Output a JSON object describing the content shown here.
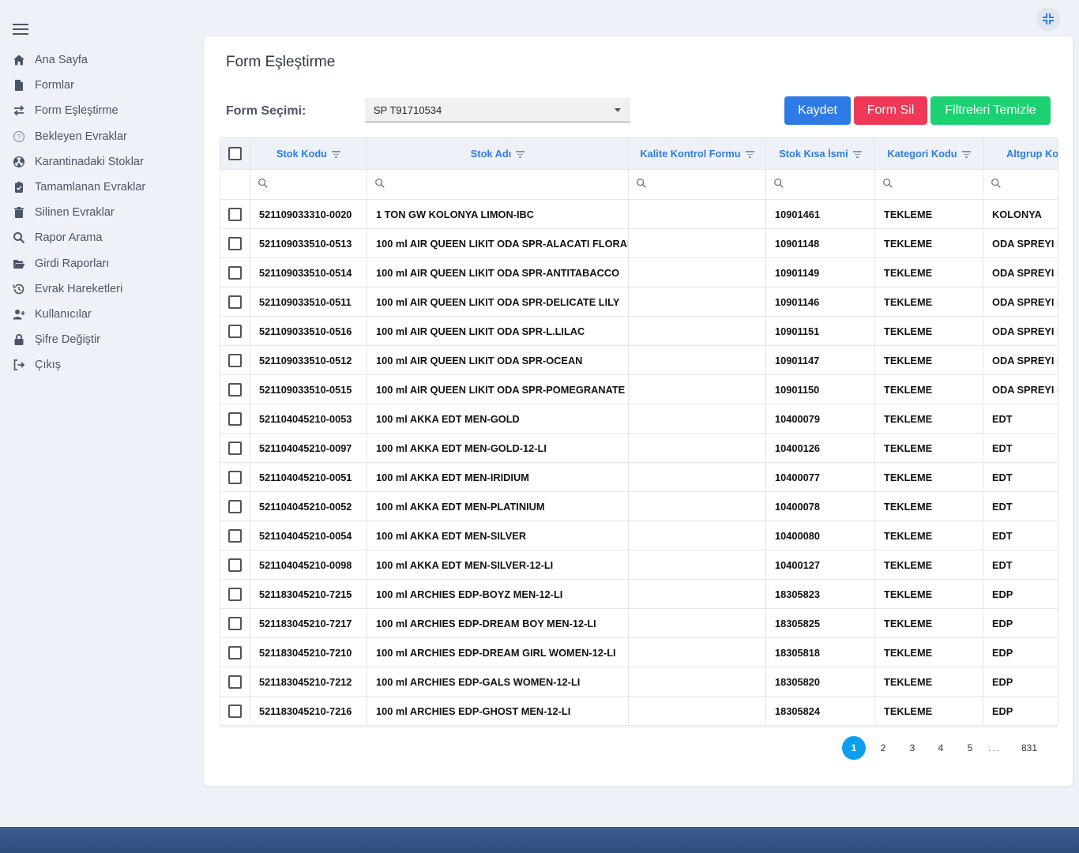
{
  "sidebar": {
    "items": [
      {
        "label": "Ana Sayfa",
        "icon": "home-icon"
      },
      {
        "label": "Formlar",
        "icon": "file-icon"
      },
      {
        "label": "Form Eşleştirme",
        "icon": "exchange-icon"
      },
      {
        "label": "Bekleyen Evraklar",
        "icon": "question-circle-icon"
      },
      {
        "label": "Karantinadaki Stoklar",
        "icon": "radiation-icon"
      },
      {
        "label": "Tamamlanan Evraklar",
        "icon": "clipboard-check-icon"
      },
      {
        "label": "Silinen Evraklar",
        "icon": "trash-icon"
      },
      {
        "label": "Rapor Arama",
        "icon": "search-icon"
      },
      {
        "label": "Girdi Raporları",
        "icon": "folder-open-icon"
      },
      {
        "label": "Evrak Hareketleri",
        "icon": "history-icon"
      },
      {
        "label": "Kullanıcılar",
        "icon": "user-plus-icon"
      },
      {
        "label": "Şifre Değiştir",
        "icon": "lock-icon"
      },
      {
        "label": "Çıkış",
        "icon": "sign-out-icon"
      }
    ]
  },
  "main": {
    "title": "Form Eşleştirme",
    "form_label": "Form Seçimi:",
    "form_select_value": "SP T91710534",
    "buttons": {
      "save": "Kaydet",
      "delete": "Form Sil",
      "clear": "Filtreleri Temizle"
    },
    "colors": {
      "save": "#2f7be6",
      "delete": "#ef3957",
      "clear": "#1bd171",
      "accent": "#2f7be6",
      "page_active": "#0aa0ee"
    }
  },
  "table": {
    "columns": [
      "Stok Kodu",
      "Stok Adı",
      "Kalite Kontrol Formu",
      "Stok Kısa İsmi",
      "Kategori Kodu",
      "Altgrup Ko"
    ],
    "rows": [
      [
        "521109033310-0020",
        "1 TON GW KOLONYA LIMON-IBC",
        "",
        "10901461",
        "TEKLEME",
        "KOLONYA"
      ],
      [
        "521109033510-0513",
        "100 ml AIR QUEEN LIKIT ODA SPR-ALACATI FLORAL",
        "",
        "10901148",
        "TEKLEME",
        "ODA SPREYI S"
      ],
      [
        "521109033510-0514",
        "100 ml AIR QUEEN LIKIT ODA SPR-ANTITABACCO",
        "",
        "10901149",
        "TEKLEME",
        "ODA SPREYI S"
      ],
      [
        "521109033510-0511",
        "100 ml AIR QUEEN LIKIT ODA SPR-DELICATE LILY",
        "",
        "10901146",
        "TEKLEME",
        "ODA SPREYI S"
      ],
      [
        "521109033510-0516",
        "100 ml AIR QUEEN LIKIT ODA SPR-L.LILAC",
        "",
        "10901151",
        "TEKLEME",
        "ODA SPREYI S"
      ],
      [
        "521109033510-0512",
        "100 ml AIR QUEEN LIKIT ODA SPR-OCEAN",
        "",
        "10901147",
        "TEKLEME",
        "ODA SPREYI S"
      ],
      [
        "521109033510-0515",
        "100 ml AIR QUEEN LIKIT ODA SPR-POMEGRANATE",
        "",
        "10901150",
        "TEKLEME",
        "ODA SPREYI S"
      ],
      [
        "521104045210-0053",
        "100 ml AKKA EDT MEN-GOLD",
        "",
        "10400079",
        "TEKLEME",
        "EDT"
      ],
      [
        "521104045210-0097",
        "100 ml AKKA EDT MEN-GOLD-12-LI",
        "",
        "10400126",
        "TEKLEME",
        "EDT"
      ],
      [
        "521104045210-0051",
        "100 ml AKKA EDT MEN-IRIDIUM",
        "",
        "10400077",
        "TEKLEME",
        "EDT"
      ],
      [
        "521104045210-0052",
        "100 ml AKKA EDT MEN-PLATINIUM",
        "",
        "10400078",
        "TEKLEME",
        "EDT"
      ],
      [
        "521104045210-0054",
        "100 ml AKKA EDT MEN-SILVER",
        "",
        "10400080",
        "TEKLEME",
        "EDT"
      ],
      [
        "521104045210-0098",
        "100 ml AKKA EDT MEN-SILVER-12-LI",
        "",
        "10400127",
        "TEKLEME",
        "EDT"
      ],
      [
        "521183045210-7215",
        "100 ml ARCHIES EDP-BOYZ MEN-12-LI",
        "",
        "18305823",
        "TEKLEME",
        "EDP"
      ],
      [
        "521183045210-7217",
        "100 ml ARCHIES EDP-DREAM BOY MEN-12-LI",
        "",
        "18305825",
        "TEKLEME",
        "EDP"
      ],
      [
        "521183045210-7210",
        "100 ml ARCHIES EDP-DREAM GIRL WOMEN-12-LI",
        "",
        "18305818",
        "TEKLEME",
        "EDP"
      ],
      [
        "521183045210-7212",
        "100 ml ARCHIES EDP-GALS WOMEN-12-LI",
        "",
        "18305820",
        "TEKLEME",
        "EDP"
      ],
      [
        "521183045210-7216",
        "100 ml ARCHIES EDP-GHOST MEN-12-LI",
        "",
        "18305824",
        "TEKLEME",
        "EDP"
      ]
    ]
  },
  "pagination": {
    "pages": [
      "1",
      "2",
      "3",
      "4",
      "5"
    ],
    "active": "1",
    "ellipsis": "...",
    "last": "831"
  }
}
